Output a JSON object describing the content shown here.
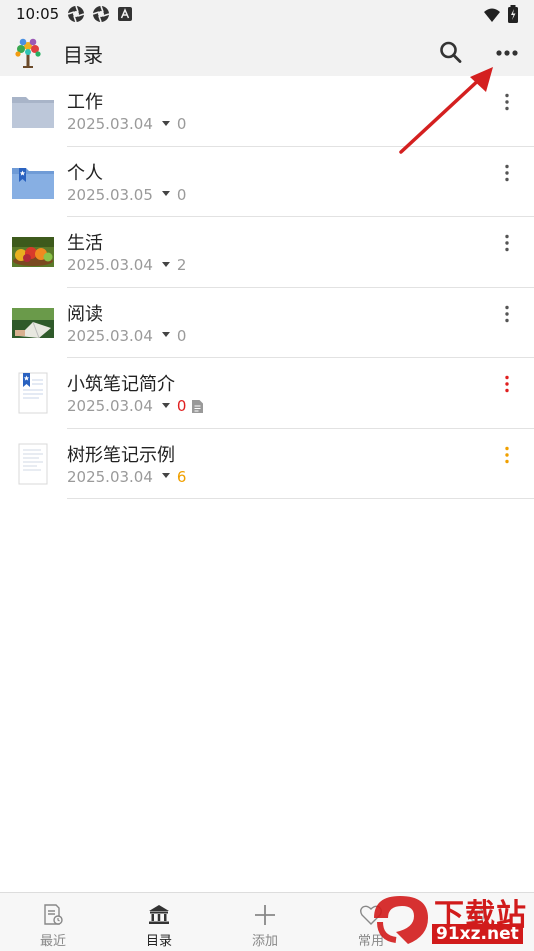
{
  "status_bar": {
    "time": "10:05",
    "left_icons": [
      "aperture-icon",
      "aperture-icon",
      "text-a-icon"
    ],
    "right_icons": [
      "wifi-icon",
      "battery-icon"
    ]
  },
  "app_bar": {
    "title": "目录",
    "logo_icon": "tree-logo-icon",
    "actions": [
      "search-icon",
      "more-horizontal-icon"
    ]
  },
  "items": [
    {
      "name": "工作",
      "date": "2025.03.04",
      "count": "0",
      "count_color": "#9a9a9a",
      "thumb": "folder-grey",
      "menu_color": "#555555",
      "has_doc_icon": false
    },
    {
      "name": "个人",
      "date": "2025.03.05",
      "count": "0",
      "count_color": "#9a9a9a",
      "thumb": "folder-blue-bookmark",
      "menu_color": "#555555",
      "has_doc_icon": false
    },
    {
      "name": "生活",
      "date": "2025.03.04",
      "count": "2",
      "count_color": "#9a9a9a",
      "thumb": "fruit-photo",
      "menu_color": "#555555",
      "has_doc_icon": false
    },
    {
      "name": "阅读",
      "date": "2025.03.04",
      "count": "0",
      "count_color": "#9a9a9a",
      "thumb": "reading-photo",
      "menu_color": "#555555",
      "has_doc_icon": false
    },
    {
      "name": "小筑笔记简介",
      "date": "2025.03.04",
      "count": "0",
      "count_color": "#e02020",
      "thumb": "note-bookmark",
      "menu_color": "#e02020",
      "has_doc_icon": true
    },
    {
      "name": "树形笔记示例",
      "date": "2025.03.04",
      "count": "6",
      "count_color": "#f0a000",
      "thumb": "note-plain",
      "menu_color": "#f0a000",
      "has_doc_icon": false
    }
  ],
  "bottom_nav": [
    {
      "label": "最近",
      "icon": "recent-note-icon",
      "active": false
    },
    {
      "label": "目录",
      "icon": "library-icon",
      "active": true
    },
    {
      "label": "添加",
      "icon": "plus-icon",
      "active": false
    },
    {
      "label": "常用",
      "icon": "heart-icon",
      "active": false
    },
    {
      "label": "",
      "icon": "settings-icon",
      "active": false
    }
  ],
  "annotation": {
    "arrow_color": "#d42020"
  },
  "watermark": {
    "line1": "下载站",
    "line2": "91xz.net"
  }
}
